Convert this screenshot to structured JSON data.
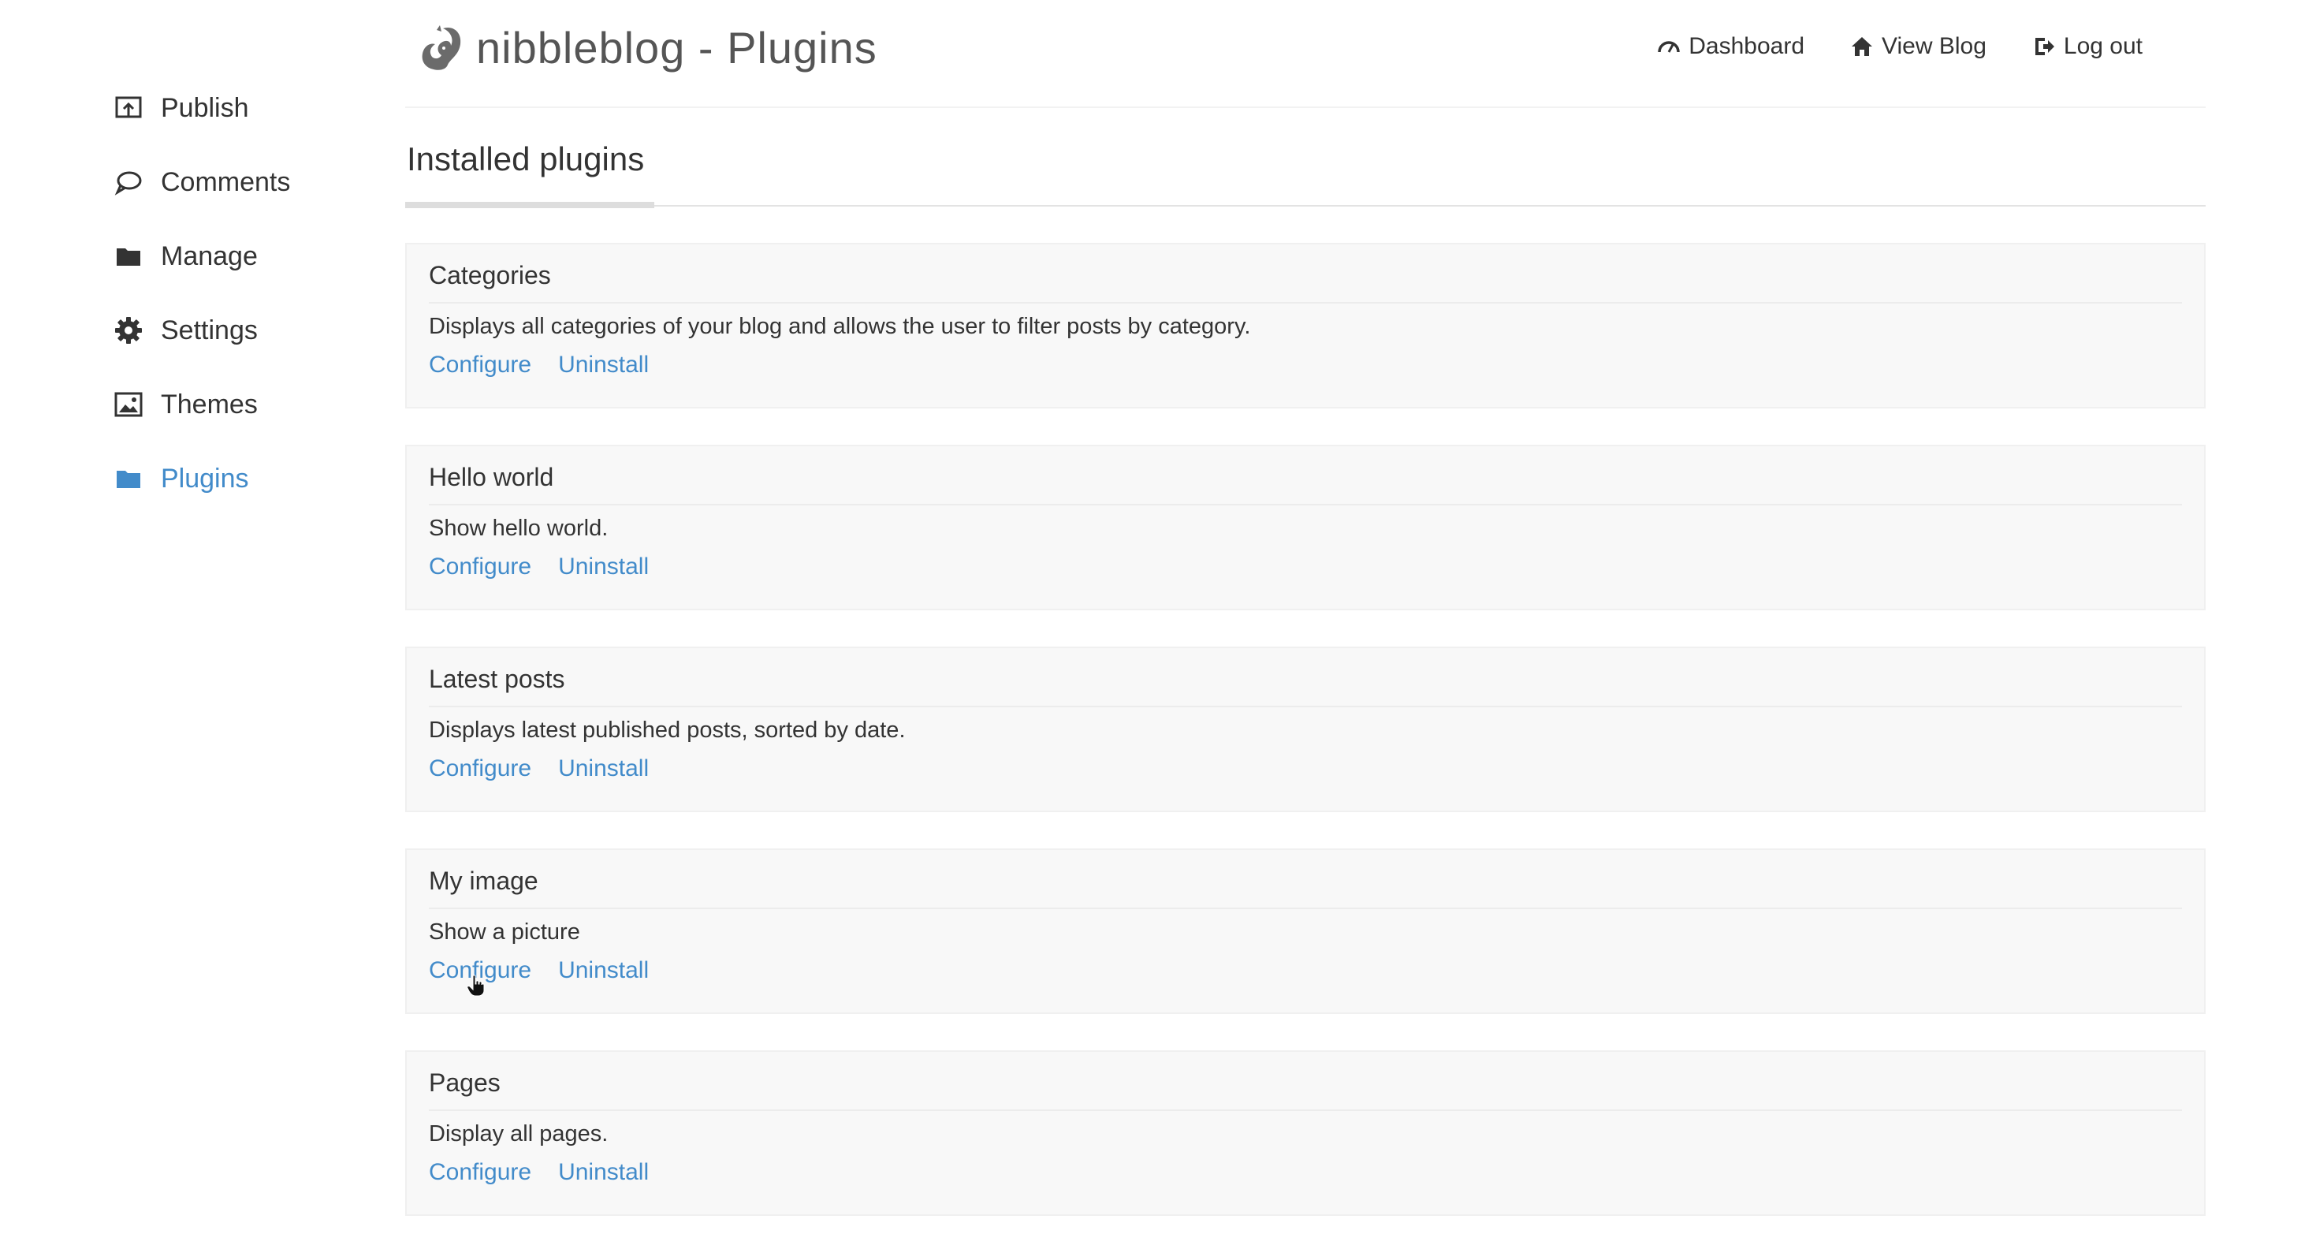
{
  "header": {
    "brand_title": "nibbleblog - Plugins",
    "nav": [
      {
        "label": "Dashboard",
        "icon": "dashboard-icon"
      },
      {
        "label": "View Blog",
        "icon": "home-icon"
      },
      {
        "label": "Log out",
        "icon": "logout-icon"
      }
    ]
  },
  "sidebar": {
    "items": [
      {
        "label": "Publish",
        "icon": "publish-icon",
        "active": false
      },
      {
        "label": "Comments",
        "icon": "comment-icon",
        "active": false
      },
      {
        "label": "Manage",
        "icon": "folder-icon",
        "active": false
      },
      {
        "label": "Settings",
        "icon": "gear-icon",
        "active": false
      },
      {
        "label": "Themes",
        "icon": "image-icon",
        "active": false
      },
      {
        "label": "Plugins",
        "icon": "folder-icon",
        "active": true
      }
    ]
  },
  "main": {
    "section_title": "Installed plugins",
    "plugins": [
      {
        "name": "Categories",
        "description": "Displays all categories of your blog and allows the user to filter posts by category.",
        "configure": "Configure",
        "uninstall": "Uninstall"
      },
      {
        "name": "Hello world",
        "description": "Show hello world.",
        "configure": "Configure",
        "uninstall": "Uninstall"
      },
      {
        "name": "Latest posts",
        "description": "Displays latest published posts, sorted by date.",
        "configure": "Configure",
        "uninstall": "Uninstall"
      },
      {
        "name": "My image",
        "description": "Show a picture",
        "configure": "Configure",
        "uninstall": "Uninstall"
      },
      {
        "name": "Pages",
        "description": "Display all pages.",
        "configure": "Configure",
        "uninstall": "Uninstall"
      }
    ]
  },
  "colors": {
    "link": "#428bca",
    "text": "#333333",
    "panel_bg": "#f8f8f8"
  }
}
